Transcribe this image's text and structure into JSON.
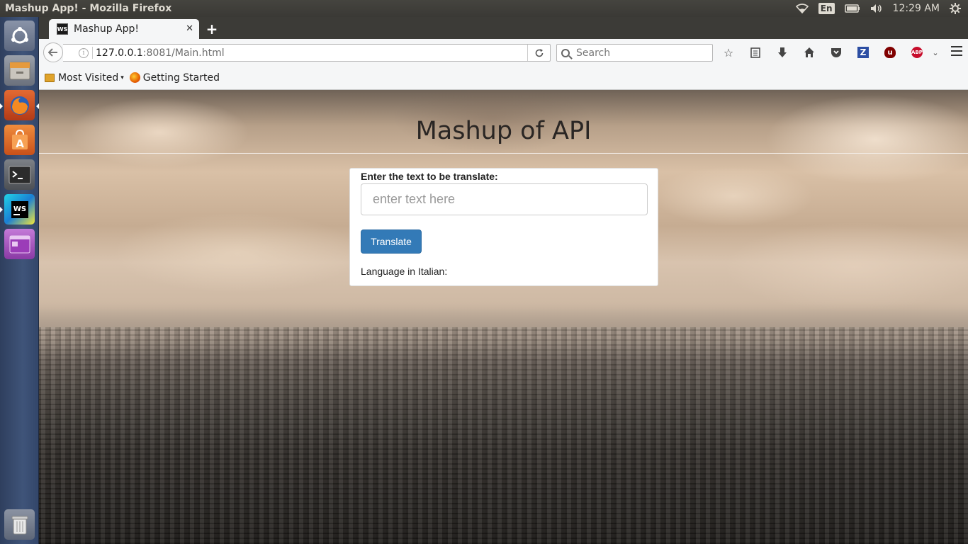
{
  "system": {
    "window_title": "Mashup App! - Mozilla Firefox",
    "keyboard_layout": "En",
    "clock": "12:29 AM"
  },
  "launcher": {
    "items": [
      {
        "name": "ubuntu-dash-icon"
      },
      {
        "name": "files-icon"
      },
      {
        "name": "firefox-icon"
      },
      {
        "name": "software-center-icon"
      },
      {
        "name": "terminal-icon"
      },
      {
        "name": "webstorm-icon"
      },
      {
        "name": "workspace-switcher-icon"
      },
      {
        "name": "trash-icon"
      }
    ]
  },
  "browser": {
    "tab_title": "Mashup App!",
    "tab_favicon_text": "WS",
    "url_host": "127.0.0.1",
    "url_rest": ":8081/Main.html",
    "search_placeholder": "Search",
    "bookmarks": [
      {
        "label": "Most Visited"
      },
      {
        "label": "Getting Started"
      }
    ],
    "abp_badge": "ABP"
  },
  "page": {
    "heading": "Mashup of API",
    "input_label": "Enter the text to be translate:",
    "input_placeholder": "enter text here",
    "input_value": "",
    "button_label": "Translate",
    "result_label": "Language in Italian:"
  },
  "colors": {
    "button_primary": "#337ab7",
    "launcher_bg": "#3f5479",
    "panel_bg": "#3c3b37"
  }
}
